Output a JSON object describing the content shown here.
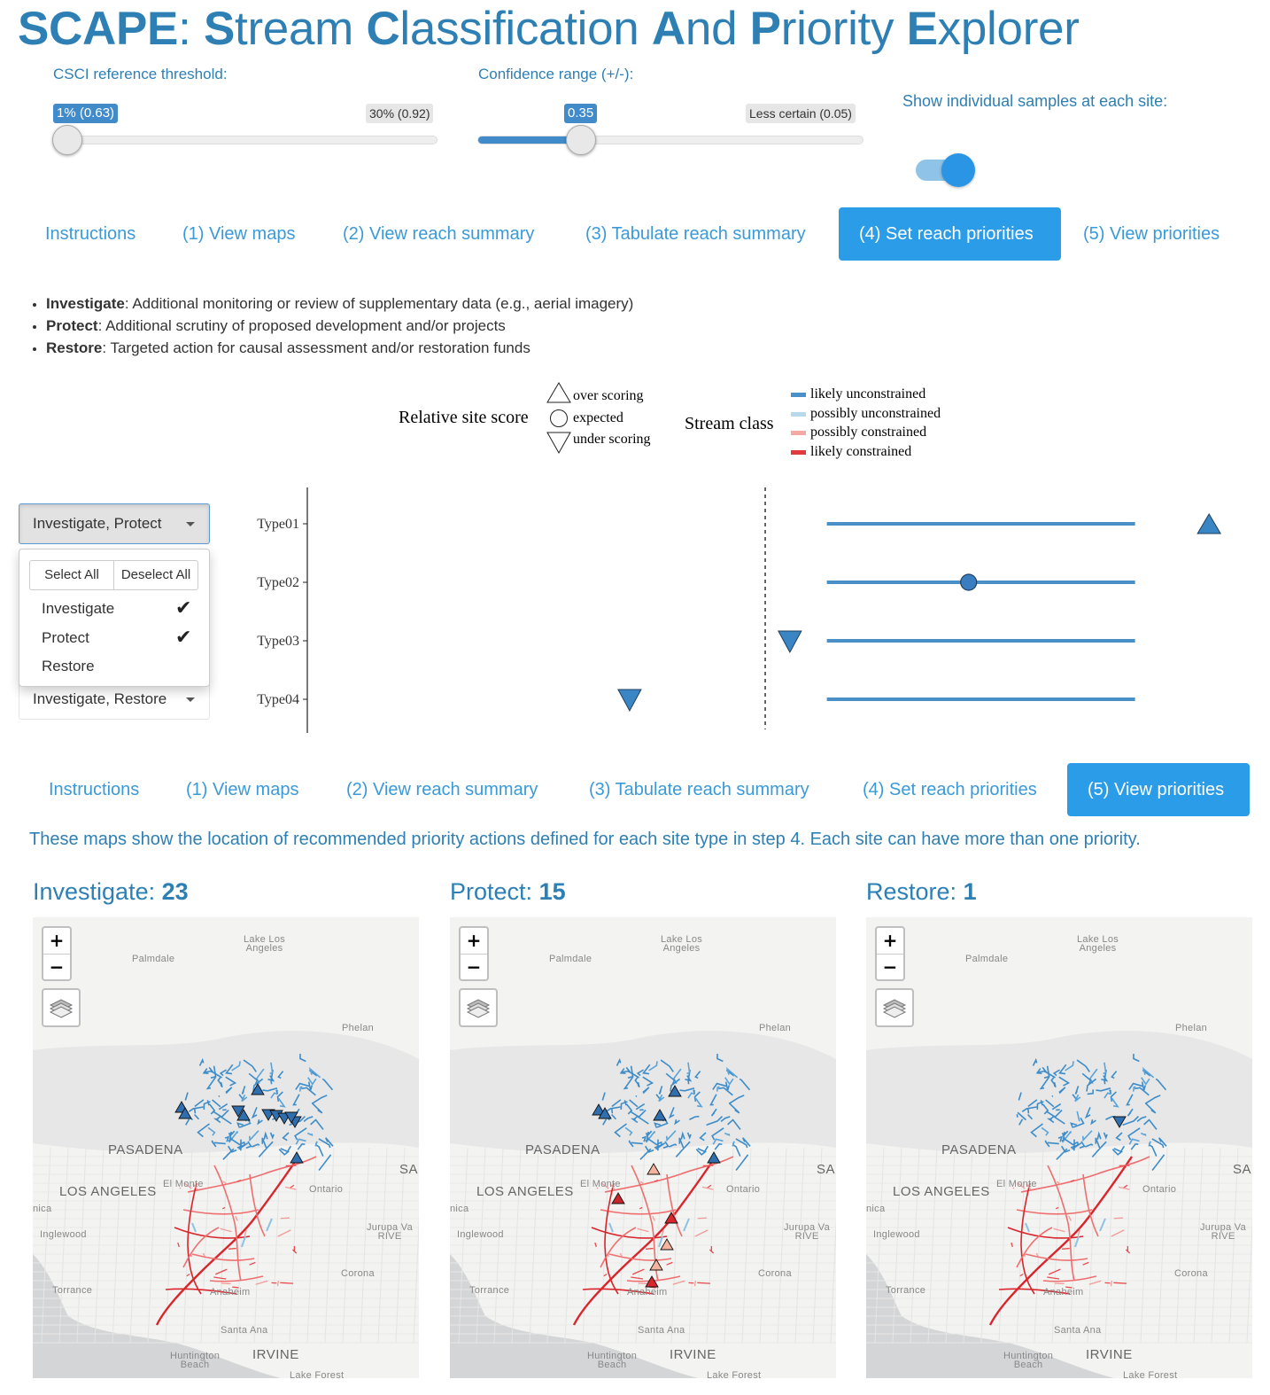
{
  "title": {
    "prefix": "SCAPE",
    "sep": ": ",
    "words": [
      {
        "cap": "S",
        "rest": "tream "
      },
      {
        "cap": "C",
        "rest": "lassification "
      },
      {
        "cap": "A",
        "rest": "nd "
      },
      {
        "cap": "P",
        "rest": "riority "
      },
      {
        "cap": "E",
        "rest": "xplorer"
      }
    ]
  },
  "controls": {
    "csci": {
      "label": "CSCI reference threshold:",
      "value_label": "1% (0.63)",
      "max_label": "30% (0.92)",
      "position": 0
    },
    "confidence": {
      "label": "Confidence range (+/-):",
      "value_label": "0.35",
      "max_label": "Less certain (0.05)",
      "position": 0.27
    },
    "samples": {
      "label": "Show individual samples at each site:",
      "on": true
    }
  },
  "tabs": [
    "Instructions",
    "(1) View maps",
    "(2) View reach summary",
    "(3) Tabulate reach summary",
    "(4) Set reach priorities",
    "(5) View priorities"
  ],
  "tabs_top_active": 4,
  "tabs_bottom_active": 5,
  "bullets": [
    {
      "term": "Investigate",
      "desc": ": Additional monitoring or review of supplementary data (e.g., aerial imagery)"
    },
    {
      "term": "Protect",
      "desc": ": Additional scrutiny of proposed development and/or projects"
    },
    {
      "term": "Restore",
      "desc": ": Targeted action for causal assessment and/or restoration funds"
    }
  ],
  "legend": {
    "score_title": "Relative site score",
    "score_items": [
      "over scoring",
      "expected",
      "under scoring"
    ],
    "class_title": "Stream class",
    "class_items": [
      {
        "label": "likely unconstrained",
        "color": "#4a90c8"
      },
      {
        "label": "possibly unconstrained",
        "color": "#b8d8ee"
      },
      {
        "label": "possibly constrained",
        "color": "#f4a9a5"
      },
      {
        "label": "likely constrained",
        "color": "#e0393e"
      }
    ]
  },
  "dropdowns": {
    "row1": "Investigate, Protect",
    "row4": "Investigate, Restore",
    "menu": {
      "select_all": "Select All",
      "deselect_all": "Deselect All",
      "options": [
        {
          "label": "Investigate",
          "checked": true
        },
        {
          "label": "Protect",
          "checked": true
        },
        {
          "label": "Restore",
          "checked": false
        }
      ]
    }
  },
  "chart_data": {
    "type": "scatter",
    "categories": [
      "Type01",
      "Type02",
      "Type03",
      "Type04"
    ],
    "ranges": [
      [
        0.72,
        0.97
      ],
      [
        0.72,
        0.97
      ],
      [
        0.72,
        0.97
      ],
      [
        0.72,
        0.97
      ]
    ],
    "points": [
      {
        "category": "Type01",
        "x": 1.03,
        "shape": "triangle-up"
      },
      {
        "category": "Type02",
        "x": 0.835,
        "shape": "circle"
      },
      {
        "category": "Type03",
        "x": 0.69,
        "shape": "triangle-down"
      },
      {
        "category": "Type04",
        "x": 0.56,
        "shape": "triangle-down"
      }
    ],
    "reference_line_x": 0.67,
    "xlim": [
      0.3,
      1.05
    ],
    "line_color": "#4a90c8"
  },
  "intro": "These maps show the location of recommended priority actions defined for each site type in step 4. Each site can have more than one priority.",
  "maps": [
    {
      "name": "Investigate",
      "count": "23"
    },
    {
      "name": "Protect",
      "count": "15"
    },
    {
      "name": "Restore",
      "count": "1"
    }
  ],
  "map_labels": {
    "zoom_in": "+",
    "zoom_out": "−",
    "places": [
      "Lake Los Angeles",
      "Palmdale",
      "Phelan",
      "PASADENA",
      "LOS ANGELES",
      "El Monte",
      "SA",
      "Ontario",
      "nica",
      "Inglewood",
      "Jurupa Va RIVE",
      "Corona",
      "Torrance",
      "Anaheim",
      "Santa Ana",
      "Huntington Beach",
      "IRVINE",
      "Lake Forest"
    ]
  }
}
